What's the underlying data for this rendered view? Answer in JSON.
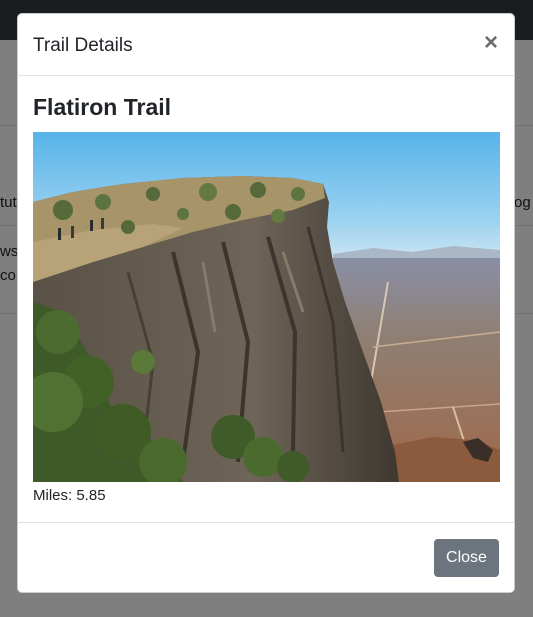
{
  "background": {
    "row_texts": [
      "tut",
      "ws.",
      "co",
      "og"
    ]
  },
  "modal": {
    "title": "Trail Details",
    "close_icon": "×",
    "trail_name": "Flatiron Trail",
    "photo_icon": "mountain-photo",
    "miles_text": "Miles: 5.85",
    "close_button_label": "Close"
  },
  "colors": {
    "backdrop": "#7a7a7a",
    "button_secondary": "#6c757d",
    "navbar": "#343a40"
  }
}
